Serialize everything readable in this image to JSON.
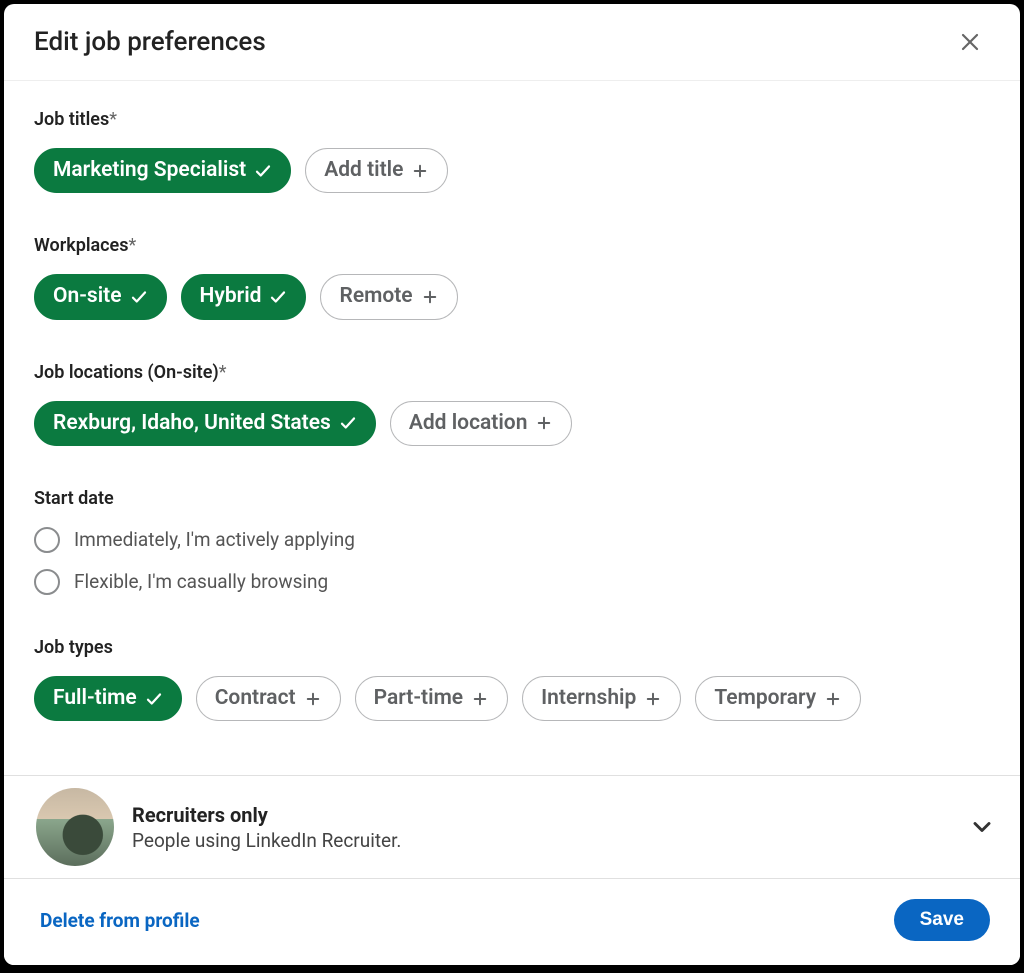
{
  "header": {
    "title": "Edit job preferences"
  },
  "sections": {
    "jobTitles": {
      "label": "Job titles",
      "required": "*",
      "pills": [
        {
          "label": "Marketing Specialist",
          "selected": true
        },
        {
          "label": "Add title",
          "selected": false
        }
      ]
    },
    "workplaces": {
      "label": "Workplaces",
      "required": "*",
      "pills": [
        {
          "label": "On-site",
          "selected": true
        },
        {
          "label": "Hybrid",
          "selected": true
        },
        {
          "label": "Remote",
          "selected": false
        }
      ]
    },
    "locations": {
      "label": "Job locations (On-site)",
      "required": "*",
      "pills": [
        {
          "label": "Rexburg, Idaho, United States",
          "selected": true
        },
        {
          "label": "Add location",
          "selected": false
        }
      ]
    },
    "startDate": {
      "label": "Start date",
      "options": [
        {
          "label": "Immediately, I'm actively applying",
          "selected": false
        },
        {
          "label": "Flexible, I'm casually browsing",
          "selected": false
        }
      ]
    },
    "jobTypes": {
      "label": "Job types",
      "pills": [
        {
          "label": "Full-time",
          "selected": true
        },
        {
          "label": "Contract",
          "selected": false
        },
        {
          "label": "Part-time",
          "selected": false
        },
        {
          "label": "Internship",
          "selected": false
        },
        {
          "label": "Temporary",
          "selected": false
        }
      ]
    }
  },
  "visibility": {
    "title": "Recruiters only",
    "subtitle": "People using LinkedIn Recruiter."
  },
  "footer": {
    "deleteLabel": "Delete from profile",
    "saveLabel": "Save"
  }
}
